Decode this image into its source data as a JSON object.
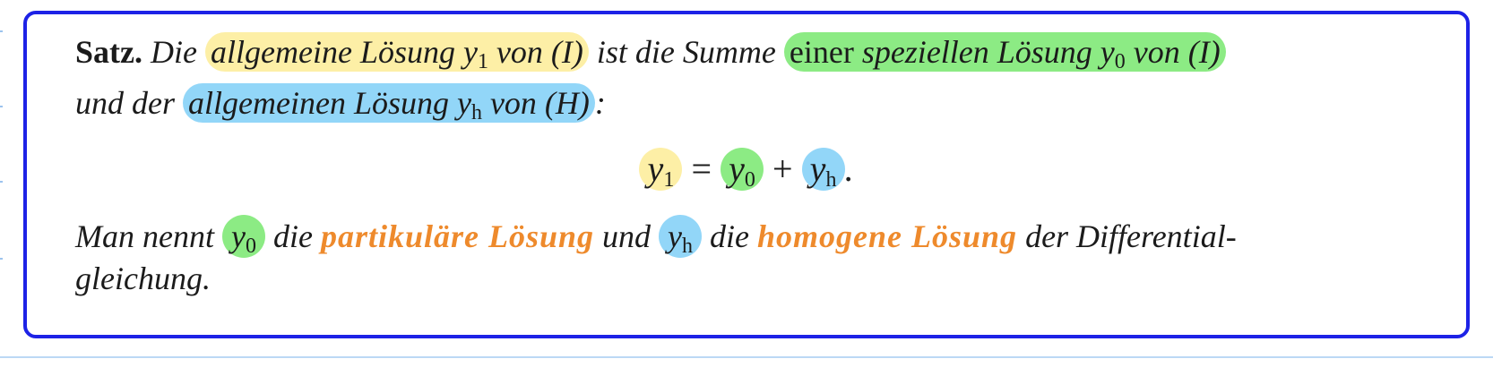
{
  "theorem": {
    "label": "Satz.",
    "line1": {
      "t1": "Die",
      "h1": "allgemeine Lösung y",
      "h1_sub": "1",
      "h1_end": " von (I)",
      "t2": "ist die Summe",
      "h2_upright": "einer",
      "h2": " speziellen Lösung y",
      "h2_sub": "0",
      "h2_end": " von (I)"
    },
    "line2": {
      "t1": "und der",
      "h1": "allgemeinen Lösung y",
      "h1_sub": "h",
      "h1_end": " von (H)",
      "t2": ":"
    },
    "formula": {
      "lhs": "y",
      "lhs_sub": "1",
      "eq": "=",
      "a": "y",
      "a_sub": "0",
      "plus": "+",
      "b": "y",
      "b_sub": "h",
      "end": "."
    },
    "line3": {
      "t1": "Man nennt",
      "v1": "y",
      "v1_sub": "0",
      "t2": "die",
      "term1": "partikuläre Lösung",
      "t3": "und",
      "v2": "y",
      "v2_sub": "h",
      "t4": "die",
      "term2": "homogene Lösung",
      "t5": "der Differential-"
    },
    "line4": {
      "t1": "gleichung."
    }
  }
}
